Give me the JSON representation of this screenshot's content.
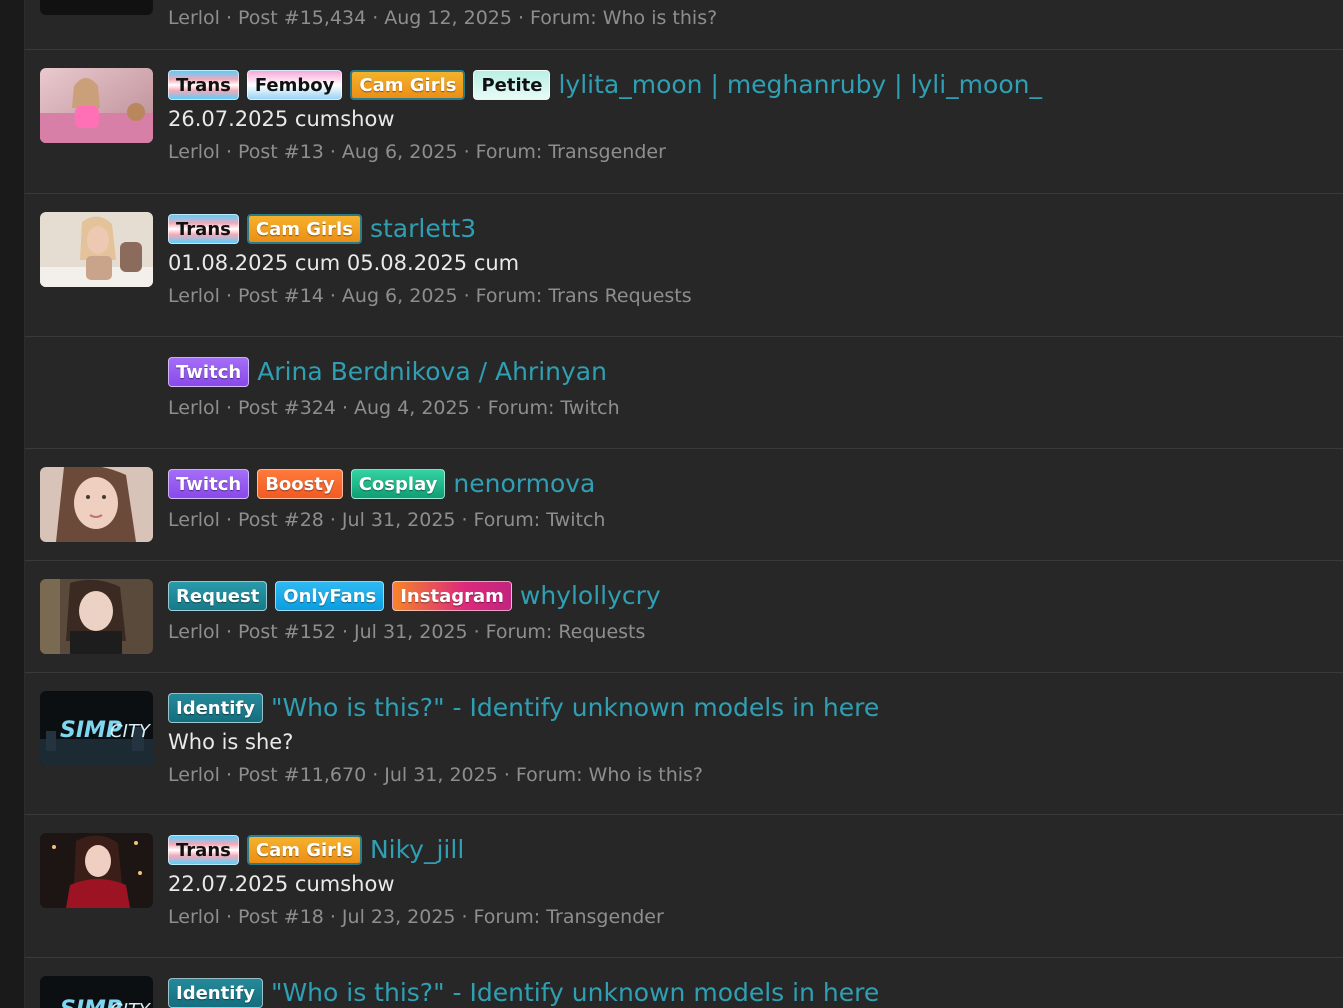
{
  "meta_separator": "·",
  "tags": {
    "trans": "Trans",
    "femboy": "Femboy",
    "cam_girls": "Cam Girls",
    "petite": "Petite",
    "twitch": "Twitch",
    "boosty": "Boosty",
    "cosplay": "Cosplay",
    "request": "Request",
    "onlyfans": "OnlyFans",
    "instagram": "Instagram",
    "identify": "Identify"
  },
  "results": [
    {
      "author": "Lerlol",
      "post": "Post #15,434",
      "date": "Aug 12, 2025",
      "forum": "Forum: Who is this?"
    },
    {
      "title": "lylita_moon | meghanruby | lyli_moon_",
      "snippet": "26.07.2025 cumshow",
      "author": "Lerlol",
      "post": "Post #13",
      "date": "Aug 6, 2025",
      "forum": "Forum: Transgender"
    },
    {
      "title": "starlett3",
      "snippet": "01.08.2025 cum 05.08.2025 cum",
      "author": "Lerlol",
      "post": "Post #14",
      "date": "Aug 6, 2025",
      "forum": "Forum: Trans Requests"
    },
    {
      "title": "Arina Berdnikova / Ahrinyan",
      "author": "Lerlol",
      "post": "Post #324",
      "date": "Aug 4, 2025",
      "forum": "Forum: Twitch"
    },
    {
      "title": "nenormova",
      "author": "Lerlol",
      "post": "Post #28",
      "date": "Jul 31, 2025",
      "forum": "Forum: Twitch"
    },
    {
      "title": "whylollycry",
      "author": "Lerlol",
      "post": "Post #152",
      "date": "Jul 31, 2025",
      "forum": "Forum: Requests"
    },
    {
      "title": "\"Who is this?\" - Identify unknown models in here",
      "snippet": "Who is she?",
      "author": "Lerlol",
      "post": "Post #11,670",
      "date": "Jul 31, 2025",
      "forum": "Forum: Who is this?"
    },
    {
      "title": "Niky_jill",
      "snippet": "22.07.2025 cumshow",
      "author": "Lerlol",
      "post": "Post #18",
      "date": "Jul 23, 2025",
      "forum": "Forum: Transgender"
    },
    {
      "title": "\"Who is this?\" - Identify unknown models in here"
    }
  ]
}
